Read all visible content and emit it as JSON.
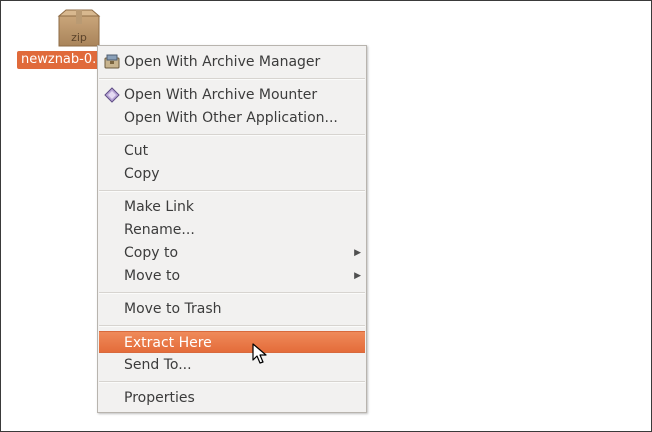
{
  "file": {
    "label": "newznab-0...",
    "icon": "zip-package-icon",
    "icon_text": "zip"
  },
  "menu": {
    "groups": [
      {
        "items": [
          {
            "label": "Open With Archive Manager",
            "icon": "archive-manager-icon"
          }
        ]
      },
      {
        "items": [
          {
            "label": "Open With Archive Mounter",
            "icon": "archive-mounter-icon"
          },
          {
            "label": "Open With Other Application..."
          }
        ]
      },
      {
        "items": [
          {
            "label": "Cut"
          },
          {
            "label": "Copy"
          }
        ]
      },
      {
        "items": [
          {
            "label": "Make Link"
          },
          {
            "label": "Rename..."
          },
          {
            "label": "Copy to",
            "submenu": true
          },
          {
            "label": "Move to",
            "submenu": true
          }
        ]
      },
      {
        "items": [
          {
            "label": "Move to Trash"
          }
        ]
      },
      {
        "items": [
          {
            "label": "Extract Here",
            "highlighted": true
          },
          {
            "label": "Send To..."
          }
        ]
      },
      {
        "items": [
          {
            "label": "Properties"
          }
        ]
      }
    ]
  },
  "colors": {
    "highlight": "#e97a4a",
    "selection": "#e06a3b",
    "menu_bg": "#f2f1f0"
  }
}
